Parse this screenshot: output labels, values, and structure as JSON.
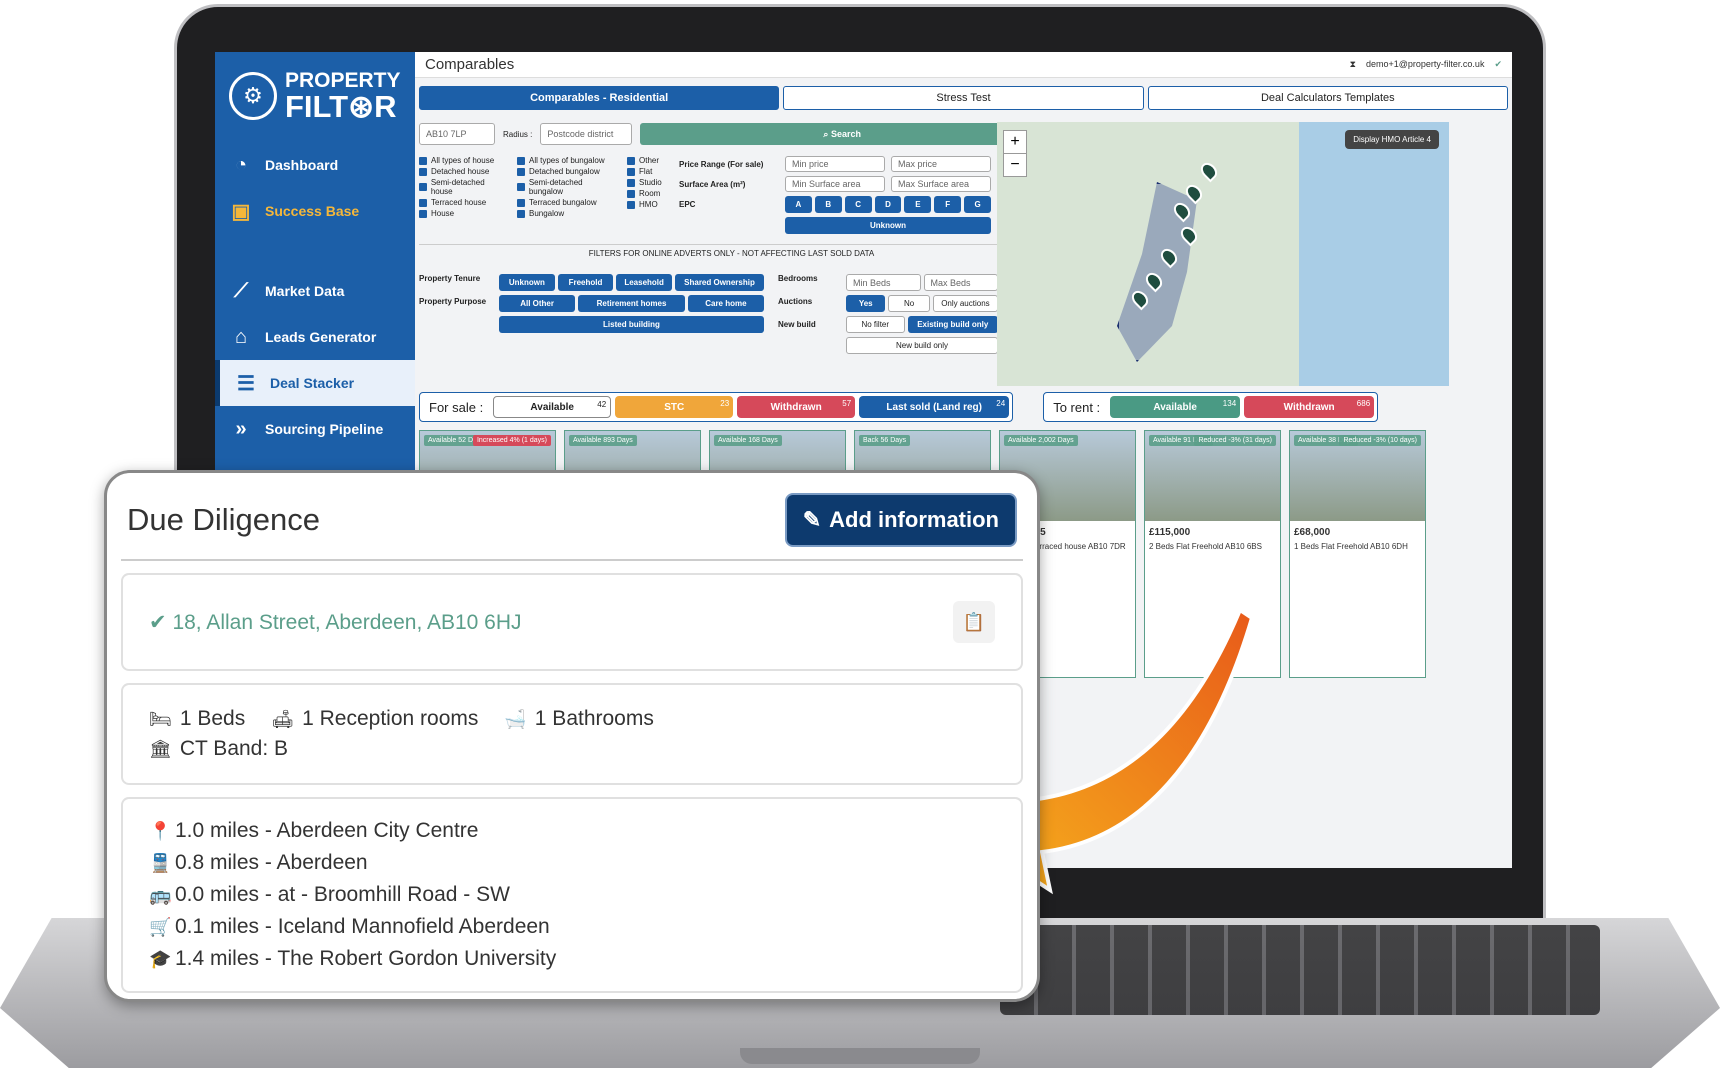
{
  "app": {
    "brand_line1": "PROPERTY",
    "brand_line2": "FILT⊛R"
  },
  "sidebar": {
    "items": [
      {
        "label": "Dashboard",
        "icon": "gauge-icon"
      },
      {
        "label": "Success Base",
        "icon": "chat-icon"
      },
      {
        "label": "Market Data",
        "icon": "chart-line-icon"
      },
      {
        "label": "Leads Generator",
        "icon": "house-icon"
      },
      {
        "label": "Deal Stacker",
        "icon": "stack-icon"
      },
      {
        "label": "Sourcing Pipeline",
        "icon": "pipeline-icon"
      }
    ]
  },
  "topbar": {
    "title": "Comparables",
    "user": "demo+1@property-filter.co.uk"
  },
  "tabs": [
    "Comparables - Residential",
    "Stress Test",
    "Deal Calculators Templates"
  ],
  "filters": {
    "postcode": "AB10 7LP",
    "radius_label": "Radius :",
    "radius_value": "Postcode district",
    "search_label": "Search",
    "house_types": [
      "All types of house",
      "Detached house",
      "Semi-detached house",
      "Terraced house",
      "House"
    ],
    "bungalow_types": [
      "All types of bungalow",
      "Detached bungalow",
      "Semi-detached bungalow",
      "Terraced bungalow",
      "Bungalow"
    ],
    "other_types": [
      "Other",
      "Flat",
      "Studio",
      "Room",
      "HMO"
    ],
    "price_label": "Price Range (For sale)",
    "min_price": "Min price",
    "max_price": "Max price",
    "surface_label": "Surface Area (m²)",
    "min_surface": "Min Surface area",
    "max_surface": "Max Surface area",
    "epc_label": "EPC",
    "epc": [
      "A",
      "B",
      "C",
      "D",
      "E",
      "F",
      "G"
    ],
    "epc_unknown": "Unknown",
    "note": "FILTERS FOR ONLINE ADVERTS ONLY - NOT AFFECTING LAST SOLD DATA",
    "tenure_label": "Property Tenure",
    "tenure": [
      "Unknown",
      "Freehold",
      "Leasehold",
      "Shared Ownership"
    ],
    "purpose_label": "Property Purpose",
    "purpose": [
      "All Other",
      "Retirement homes",
      "Care home"
    ],
    "listed": "Listed building",
    "bedrooms_label": "Bedrooms",
    "min_beds": "Min Beds",
    "max_beds": "Max Beds",
    "auctions_label": "Auctions",
    "auctions": [
      "Yes",
      "No",
      "Only auctions"
    ],
    "newbuild_label": "New build",
    "newbuild": [
      "No filter",
      "Existing build only",
      "New build only"
    ]
  },
  "map": {
    "hmo_label": "Display HMO Article 4",
    "zoom_in": "+",
    "zoom_out": "−"
  },
  "status": {
    "for_sale_label": "For sale :",
    "to_rent_label": "To rent :",
    "sale": [
      {
        "label": "Available",
        "count": "42",
        "color": "#ffffff"
      },
      {
        "label": "STC",
        "count": "23",
        "color": "#f0a63a"
      },
      {
        "label": "Withdrawn",
        "count": "57",
        "color": "#d6495a"
      },
      {
        "label": "Last sold (Land reg)",
        "count": "24",
        "color": "#1c5fa8"
      }
    ],
    "rent": [
      {
        "label": "Available",
        "count": "134",
        "color": "#4a9a84"
      },
      {
        "label": "Withdrawn",
        "count": "686",
        "color": "#d6495a"
      }
    ]
  },
  "cards": [
    {
      "badge": "Available 52 Days",
      "badge2": "Increased 4% (1 days)",
      "price": "",
      "info": ""
    },
    {
      "badge": "Available 893 Days",
      "badge2": "",
      "price": "",
      "info": ""
    },
    {
      "badge": "Available 168 Days",
      "badge2": "",
      "price": "",
      "info": ""
    },
    {
      "badge": "Back 56 Days",
      "badge2": "",
      "price": "",
      "info": ""
    },
    {
      "badge": "Available 2,002 Days",
      "badge2": "",
      "price": "£149,995",
      "info": "3 Beds Terraced house AB10 7DR"
    },
    {
      "badge": "Available 91 Days",
      "badge2": "Reduced -3% (31 days)",
      "price": "£115,000",
      "info": "2 Beds Flat Freehold AB10 6BS"
    },
    {
      "badge": "Available 38 Days",
      "badge2": "Reduced -3% (10 days)",
      "price": "£68,000",
      "info": "1 Beds Flat Freehold AB10 6DH"
    }
  ],
  "due_diligence": {
    "title": "Due Diligence",
    "add_label": "Add information",
    "address": "18, Allan Street, Aberdeen, AB10 6HJ",
    "beds": "1 Beds",
    "reception": "1 Reception rooms",
    "bathrooms": "1 Bathrooms",
    "ct_band": "CT Band: B",
    "nearby": [
      {
        "icon": "pin-icon",
        "text": "1.0 miles - Aberdeen City Centre"
      },
      {
        "icon": "train-icon",
        "text": "0.8 miles - Aberdeen"
      },
      {
        "icon": "bus-icon",
        "text": "0.0 miles - at - Broomhill Road - SW"
      },
      {
        "icon": "cart-icon",
        "text": "0.1 miles - Iceland Mannofield Aberdeen"
      },
      {
        "icon": "graduation-cap-icon",
        "text": "1.4 miles - The Robert Gordon University"
      }
    ]
  }
}
